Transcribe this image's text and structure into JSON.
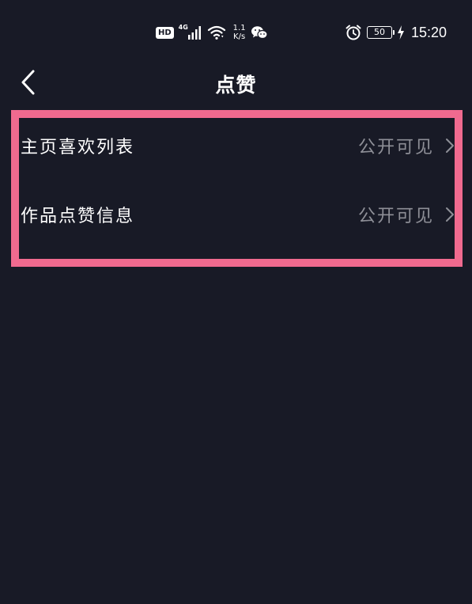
{
  "status_bar": {
    "hd_badge": "HD",
    "network_type": "4G",
    "net_speed_value": "1.1",
    "net_speed_unit": "K/s",
    "battery_level": "50",
    "time": "15:20",
    "icons": [
      "hd-icon",
      "signal-icon",
      "wifi-icon",
      "wechat-icon",
      "alarm-icon",
      "battery-icon",
      "charging-icon"
    ]
  },
  "header": {
    "back_icon": "chevron-left-icon",
    "title": "点赞"
  },
  "settings": {
    "items": [
      {
        "label": "主页喜欢列表",
        "value": "公开可见",
        "icon": "chevron-right-icon"
      },
      {
        "label": "作品点赞信息",
        "value": "公开可见",
        "icon": "chevron-right-icon"
      }
    ]
  },
  "colors": {
    "background": "#181a26",
    "highlight_border": "#f06a8f",
    "secondary_text": "#8e8f97",
    "primary_text": "#ffffff"
  }
}
